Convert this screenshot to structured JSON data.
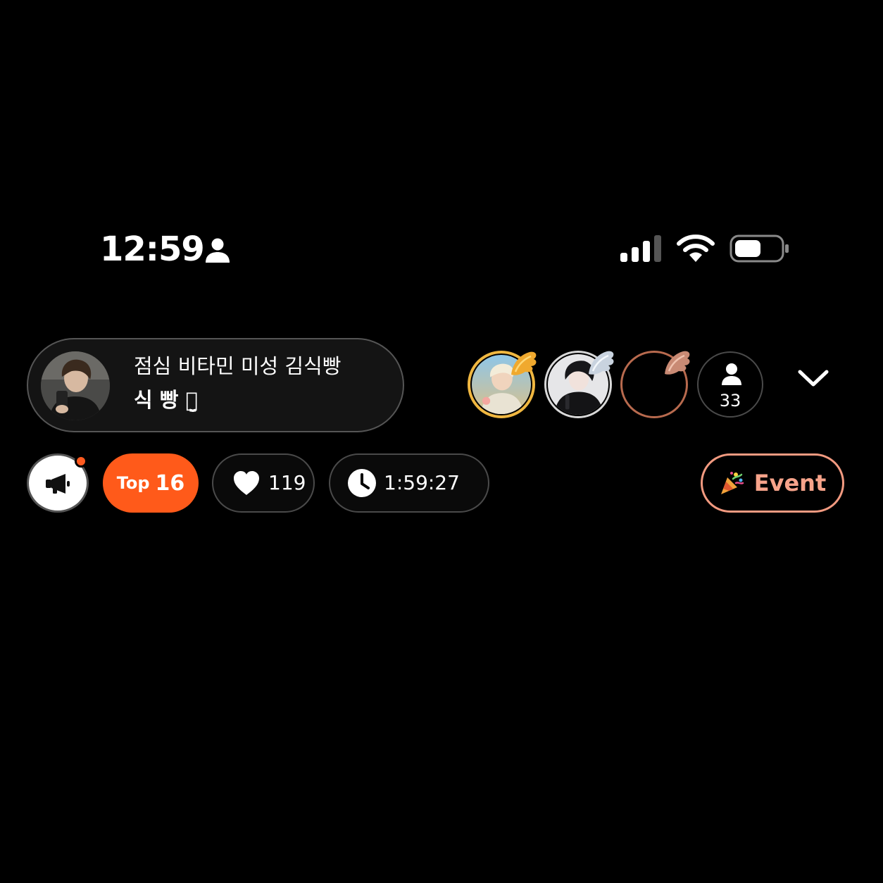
{
  "status_bar": {
    "time": "12:59",
    "icons": [
      "person-icon",
      "cellular-signal-icon",
      "wifi-icon",
      "battery-icon"
    ]
  },
  "host": {
    "title": "점심 비타민 미성 김식빵",
    "name": "식 빵 ꪔ̤̮",
    "avatar": "host-avatar"
  },
  "viewers": {
    "count": "33",
    "top_frames": [
      "gold",
      "silver",
      "bronze"
    ]
  },
  "badges": {
    "top_label": "Top",
    "top_rank": "16",
    "likes": "119",
    "timer": "1:59:27",
    "event_label": "Event"
  },
  "colors": {
    "accent_orange": "#ff5a1a",
    "event_text": "#f7a38a",
    "gold_frame": "#f0b740",
    "bronze_frame": "#b86a4e"
  }
}
